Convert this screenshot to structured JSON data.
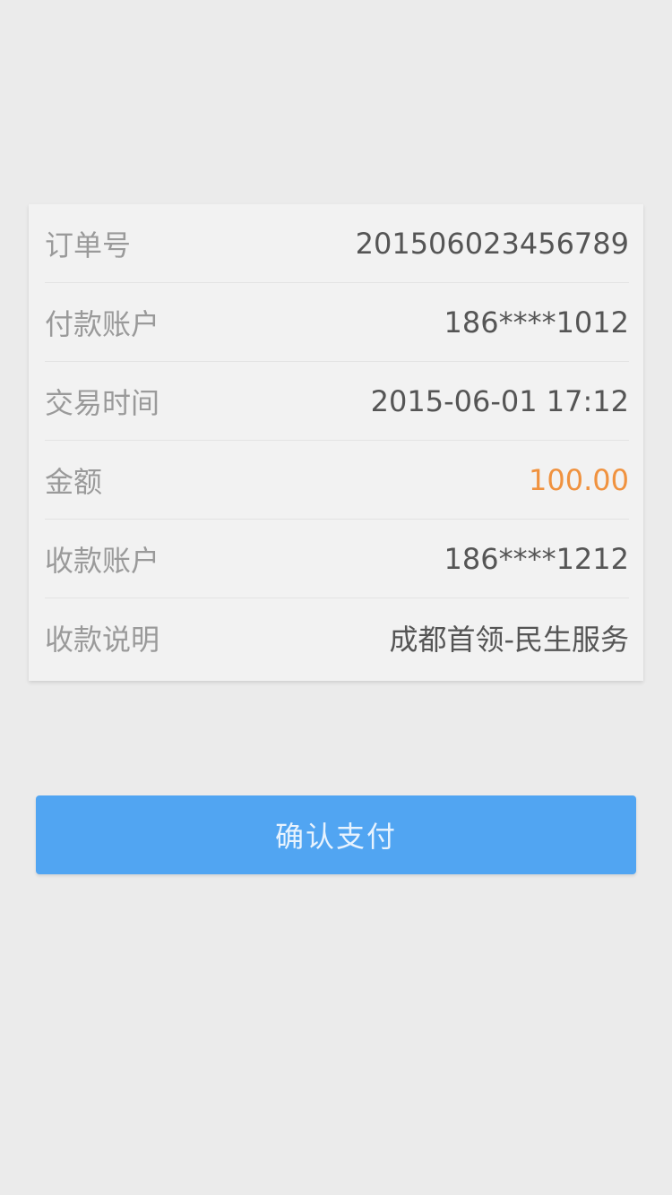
{
  "details": [
    {
      "label": "订单号",
      "value": "201506023456789"
    },
    {
      "label": "付款账户",
      "value": "186****1012"
    },
    {
      "label": "交易时间",
      "value": "2015-06-01  17:12"
    },
    {
      "label": "金额",
      "value": "100.00"
    },
    {
      "label": "收款账户",
      "value": "186****1212"
    },
    {
      "label": "收款说明",
      "value": "成都首领-民生服务"
    }
  ],
  "button": {
    "label": "确认支付"
  },
  "colors": {
    "background": "#ebebeb",
    "card": "#f2f2f2",
    "amount": "#f0923f",
    "button": "#51a5f2"
  }
}
